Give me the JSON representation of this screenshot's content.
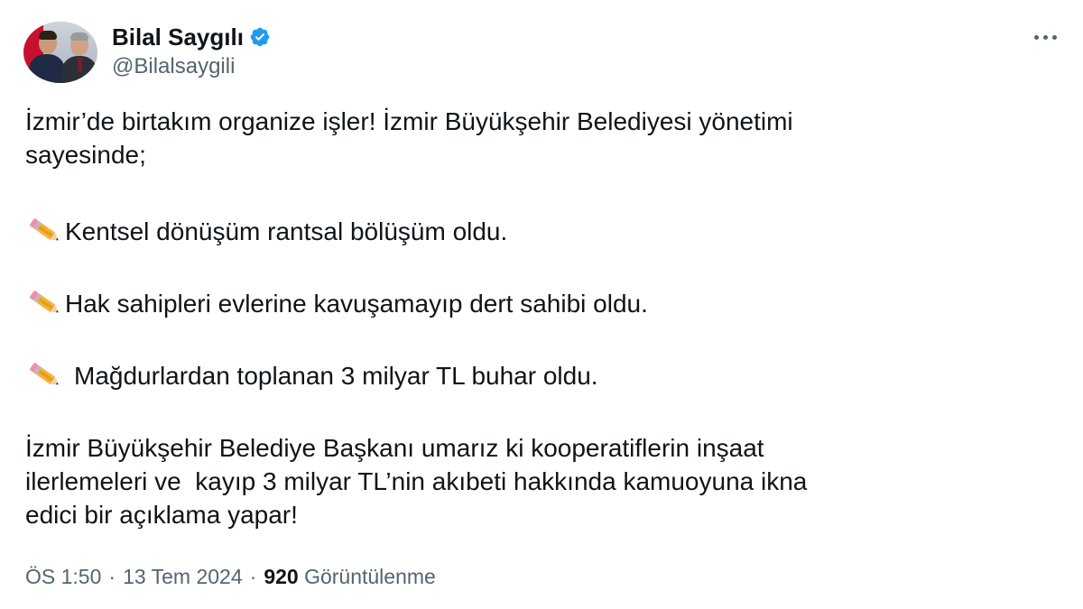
{
  "author": {
    "name": "Bilal Saygılı",
    "handle": "@Bilalsaygili",
    "verified": true,
    "verified_color": "#1d9bf0"
  },
  "tweet": {
    "paragraph1": [
      "İzmir’de birtakım organize işler! İzmir Büyükşehir Belediyesi yönetimi",
      "sayesinde;"
    ],
    "bullet_icon": "pencil-emoji",
    "bullets": [
      "Kentsel dönüşüm rantsal bölüşüm oldu.",
      "Hak sahipleri evlerine kavuşamayıp dert sahibi oldu.",
      "Mağdurlardan toplanan 3 milyar TL buhar oldu."
    ],
    "paragraph2": [
      "İzmir Büyükşehir Belediye Başkanı umarız ki kooperatiflerin inşaat",
      "ilerlemeleri ve  kayıp 3 milyar TL’nin akıbeti hakkında kamuoyuna ikna",
      "edici bir açıklama yapar!"
    ]
  },
  "meta": {
    "time": "ÖS 1:50",
    "date": "13 Tem 2024",
    "separator": "·",
    "views_count": "920",
    "views_label": "Görüntülenme"
  },
  "icons": {
    "more": "more-dots-icon",
    "verified": "verified-badge-icon"
  }
}
